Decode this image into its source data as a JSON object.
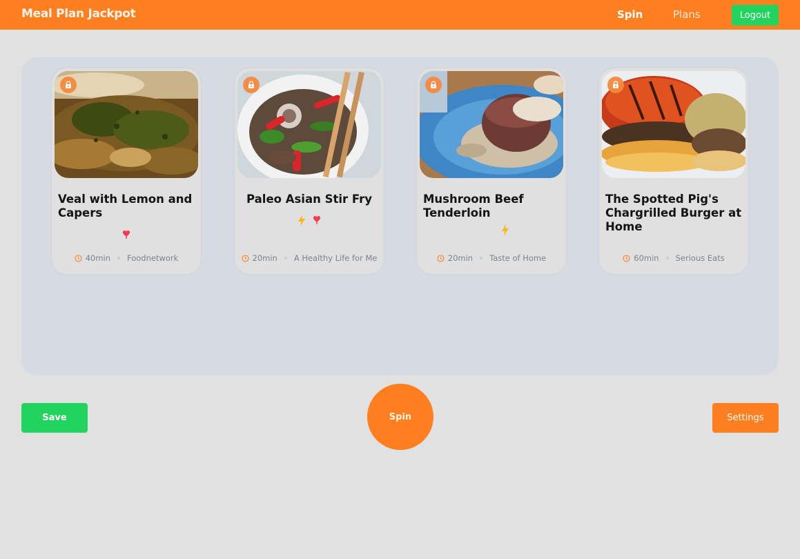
{
  "app": {
    "title": "Meal Plan Jackpot",
    "nav": {
      "spin": "Spin",
      "plans": "Plans"
    },
    "logout_label": "Logout"
  },
  "colors": {
    "primary": "#fe7f1f",
    "success": "#22d35f",
    "panel": "#d6dae2",
    "quick_icon": "#f7b91b",
    "heart_icon": "#ee3e4f"
  },
  "recipes": [
    {
      "title": "Veal with Lemon and Capers",
      "time": "40min",
      "source": "Foodnetwork",
      "tags": [
        "heart-icon"
      ],
      "locked_icon": "lock-icon"
    },
    {
      "title": "Paleo Asian Stir Fry",
      "time": "20min",
      "source": "A Healthy Life for Me",
      "tags": [
        "lightning-icon",
        "heart-icon"
      ],
      "locked_icon": "lock-icon"
    },
    {
      "title": "Mushroom Beef Tenderloin",
      "time": "20min",
      "source": "Taste of Home",
      "tags": [
        "lightning-icon"
      ],
      "locked_icon": "lock-icon"
    },
    {
      "title": "The Spotted Pig's Chargrilled Burger at Home",
      "time": "60min",
      "source": "Serious Eats",
      "tags": [],
      "locked_icon": "lock-icon"
    }
  ],
  "actions": {
    "save_label": "Save",
    "spin_label": "Spin",
    "settings_label": "Settings"
  }
}
